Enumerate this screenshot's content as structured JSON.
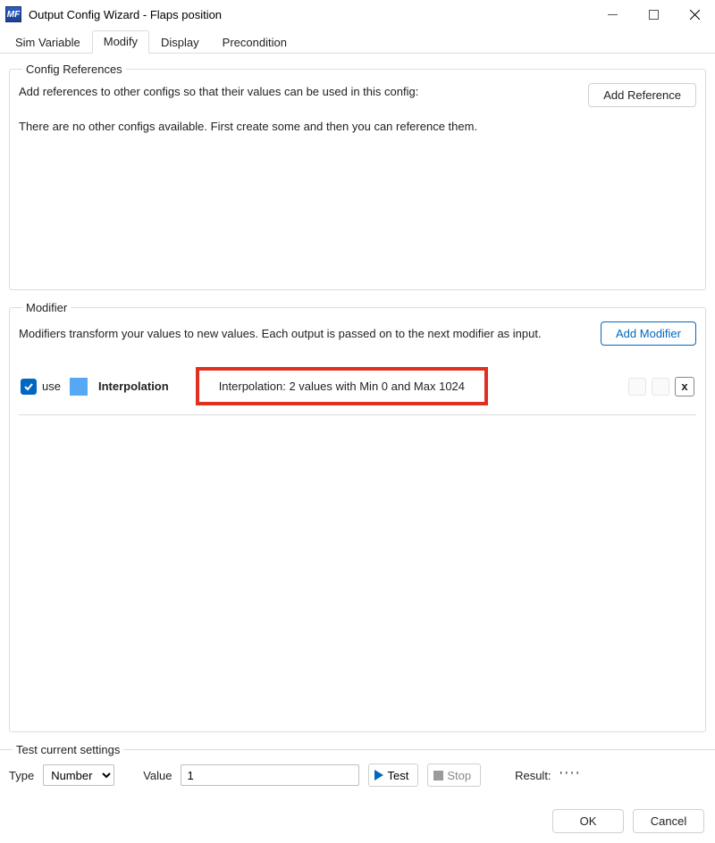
{
  "window": {
    "title": "Output Config Wizard - Flaps position",
    "app_icon_text": "MF"
  },
  "tabs": [
    {
      "label": "Sim Variable",
      "active": false
    },
    {
      "label": "Modify",
      "active": true
    },
    {
      "label": "Display",
      "active": false
    },
    {
      "label": "Precondition",
      "active": false
    }
  ],
  "config_refs": {
    "legend": "Config References",
    "help": "Add references to other configs so that their values can be used in this config:",
    "empty_msg": "There are no other configs available. First create some and then you can reference them.",
    "add_btn": "Add Reference"
  },
  "modifier": {
    "legend": "Modifier",
    "help": "Modifiers transform your values to new values. Each output is passed on to the next modifier as input.",
    "add_btn": "Add Modifier",
    "row": {
      "use_checked": true,
      "use_label": "use",
      "name": "Interpolation",
      "description": "Interpolation: 2 values with Min 0 and Max 1024",
      "delete_label": "x"
    }
  },
  "test": {
    "legend": "Test current settings",
    "type_label": "Type",
    "type_options": [
      "Number"
    ],
    "type_selected": "Number",
    "value_label": "Value",
    "value": "1",
    "test_btn": "Test",
    "stop_btn": "Stop",
    "result_label": "Result:",
    "result_value": "' ' ' '"
  },
  "buttons": {
    "ok": "OK",
    "cancel": "Cancel"
  }
}
